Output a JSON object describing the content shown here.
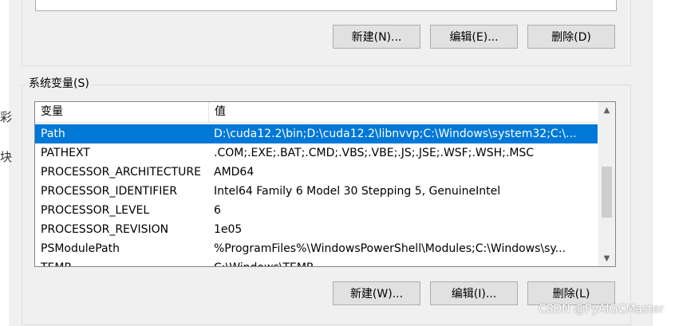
{
  "side_glyphs": [
    "彩",
    "块"
  ],
  "user_vars": {
    "new_button": "新建(N)...",
    "edit_button": "编辑(E)...",
    "delete_button": "删除(D)"
  },
  "system_vars": {
    "group_title": "系统变量(S)",
    "columns": {
      "variable": "变量",
      "value": "值"
    },
    "rows": [
      {
        "variable": "Path",
        "value": "D:\\cuda12.2\\bin;D:\\cuda12.2\\libnvvp;C:\\Windows\\system32;C:\\...",
        "selected": true
      },
      {
        "variable": "PATHEXT",
        "value": ".COM;.EXE;.BAT;.CMD;.VBS;.VBE;.JS;.JSE;.WSF;.WSH;.MSC"
      },
      {
        "variable": "PROCESSOR_ARCHITECTURE",
        "value": "AMD64"
      },
      {
        "variable": "PROCESSOR_IDENTIFIER",
        "value": "Intel64 Family 6 Model 30 Stepping 5, GenuineIntel"
      },
      {
        "variable": "PROCESSOR_LEVEL",
        "value": "6"
      },
      {
        "variable": "PROCESSOR_REVISION",
        "value": "1e05"
      },
      {
        "variable": "PSModulePath",
        "value": "%ProgramFiles%\\WindowsPowerShell\\Modules;C:\\Windows\\sy..."
      },
      {
        "variable": "TEMP",
        "value": "C:\\Windows\\TEMP"
      }
    ],
    "new_button": "新建(W)...",
    "edit_button": "编辑(I)...",
    "delete_button": "删除(L)"
  },
  "watermark": "CSDN @PyAIGCMaster",
  "colors": {
    "selection": "#0078d7",
    "dialog_bg": "#f0f0f0",
    "button_bg": "#e1e1e1"
  }
}
